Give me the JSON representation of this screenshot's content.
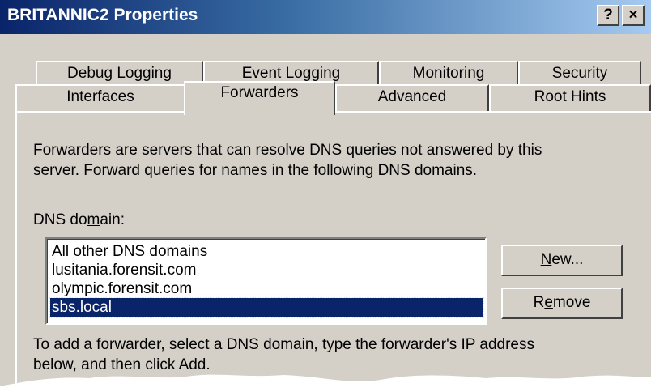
{
  "window": {
    "title": "BRITANNIC2 Properties",
    "help_label": "?",
    "close_label": "×"
  },
  "tabs": {
    "row1": [
      {
        "label": "Debug Logging"
      },
      {
        "label": "Event Logging"
      },
      {
        "label": "Monitoring"
      },
      {
        "label": "Security"
      }
    ],
    "row2": [
      {
        "label": "Interfaces"
      },
      {
        "label": "Forwarders",
        "selected": true
      },
      {
        "label": "Advanced"
      },
      {
        "label": "Root Hints"
      }
    ]
  },
  "forwarders": {
    "intro_line1": "Forwarders are servers that can resolve DNS queries not answered by this",
    "intro_line2": "server. Forward queries for names in the following DNS domains.",
    "dns_domain_label_pre": "DNS do",
    "dns_domain_label_u": "m",
    "dns_domain_label_post": "ain:",
    "domains": [
      {
        "label": "All other DNS domains"
      },
      {
        "label": "lusitania.forensit.com"
      },
      {
        "label": "olympic.forensit.com"
      },
      {
        "label": "sbs.local",
        "selected": true
      }
    ],
    "new_button_u": "N",
    "new_button_rest": "ew...",
    "remove_button_pre": "R",
    "remove_button_u": "e",
    "remove_button_post": "move",
    "hint_line1": "To add a forwarder, select a DNS domain, type the forwarder's IP address",
    "hint_line2": "below, and then click Add."
  },
  "colors": {
    "title_bar": "#0a246a",
    "face": "#d4d0c8",
    "selection": "#0a246a"
  }
}
